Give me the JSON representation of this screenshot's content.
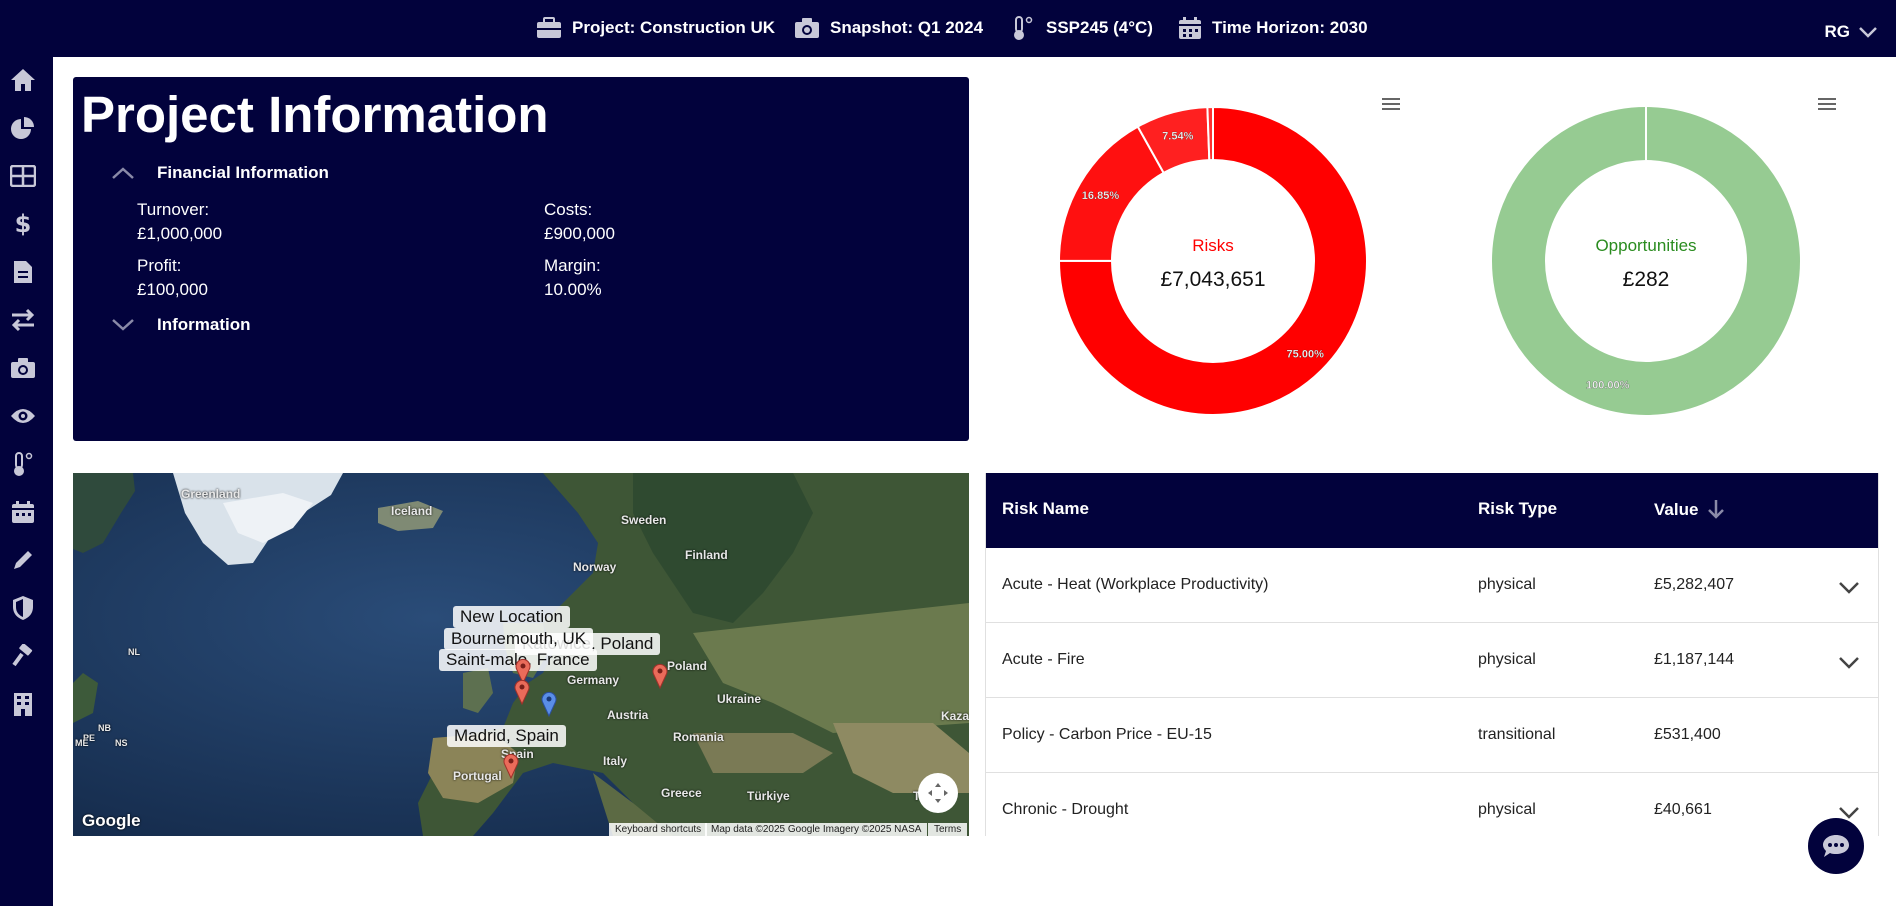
{
  "topbar": {
    "project": "Project: Construction UK",
    "snapshot": "Snapshot: Q1 2024",
    "scenario": "SSP245 (4°C)",
    "horizon": "Time Horizon: 2030",
    "user": "RG",
    "icons": [
      "briefcase-icon",
      "camera-icon",
      "thermometer-icon",
      "calendar-icon",
      "chevron-down-icon"
    ]
  },
  "sidebar": {
    "items": [
      "home-icon",
      "pie-chart-icon",
      "table-icon",
      "dollar-icon",
      "document-icon",
      "swap-icon",
      "camera-icon",
      "eye-icon",
      "thermometer-icon",
      "calendar-icon",
      "pencil-icon",
      "shield-icon",
      "hammer-icon",
      "building-icon"
    ]
  },
  "project_info": {
    "title": "Project Information",
    "financial_section": "Financial Information",
    "turnover_label": "Turnover:",
    "turnover_value": "£1,000,000",
    "costs_label": "Costs:",
    "costs_value": "£900,000",
    "profit_label": "Profit:",
    "profit_value": "£100,000",
    "margin_label": "Margin:",
    "margin_value": "10.00%",
    "info_section": "Information"
  },
  "chart_data": [
    {
      "type": "pie",
      "title": "Risks",
      "center_value": "£7,043,651",
      "slices": [
        {
          "label": "Acute - Heat (Workplace Productivity)",
          "value": 75.0,
          "display": "75.00%",
          "color": "#ff0000"
        },
        {
          "label": "Acute - Fire",
          "value": 16.85,
          "display": "16.85%",
          "color": "#ff1010"
        },
        {
          "label": "Policy - Carbon Price - EU-15",
          "value": 7.54,
          "display": "7.54%",
          "color": "#ff2020"
        },
        {
          "label": "Chronic - Drought",
          "value": 0.58,
          "display": "",
          "color": "#ff3030"
        }
      ],
      "title_color": "#ff0000"
    },
    {
      "type": "pie",
      "title": "Opportunities",
      "center_value": "£282",
      "slices": [
        {
          "label": "",
          "value": 100.0,
          "display": "100.00%",
          "color": "#96cb92"
        }
      ],
      "title_color": "#2a8c1f"
    }
  ],
  "map": {
    "labels": {
      "new_location": "New Location",
      "bournemouth": "Bournemouth, UK",
      "katowice": "Katowice, Poland",
      "saint_malo": "Saint-malo, France",
      "madrid": "Madrid, Spain"
    },
    "geo": [
      "Greenland",
      "Iceland",
      "Sweden",
      "Finland",
      "Norway",
      "Germany",
      "Poland",
      "Ukraine",
      "Austria",
      "Romania",
      "Italy",
      "Spain",
      "Portugal",
      "Greece",
      "Türkiye",
      "Turkm",
      "Kaza",
      "NL",
      "NB",
      "PE",
      "NS",
      "ME"
    ],
    "brand": "Google",
    "shortcuts": "Keyboard shortcuts",
    "attribution": "Map data ©2025 Google Imagery ©2025 NASA",
    "terms": "Terms"
  },
  "risk_table": {
    "headers": [
      "Risk Name",
      "Risk Type",
      "Value"
    ],
    "sort_icon": "arrow-down-icon",
    "rows": [
      {
        "name": "Acute - Heat (Workplace Productivity)",
        "type": "physical",
        "value": "£5,282,407",
        "expandable": true
      },
      {
        "name": "Acute - Fire",
        "type": "physical",
        "value": "£1,187,144",
        "expandable": true
      },
      {
        "name": "Policy - Carbon Price - EU-15",
        "type": "transitional",
        "value": "£531,400",
        "expandable": false
      },
      {
        "name": "Chronic - Drought",
        "type": "physical",
        "value": "£40,661",
        "expandable": true
      }
    ]
  },
  "chat": {
    "icon": "chat-icon"
  }
}
